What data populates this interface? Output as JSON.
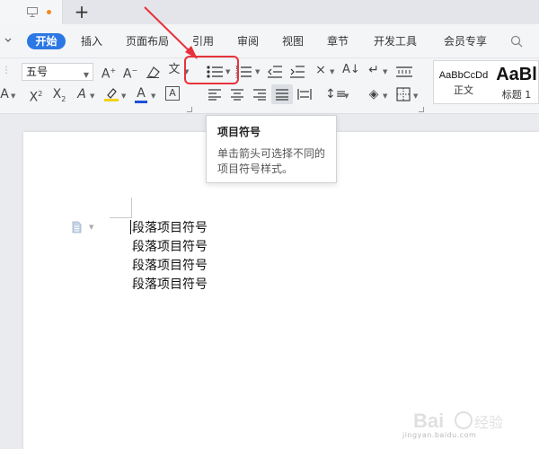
{
  "tabstrip": {
    "new_tab_symbol": "+",
    "unsaved_dot_color": "#f08a1c"
  },
  "menu": {
    "items": [
      "开始",
      "插入",
      "页面布局",
      "引用",
      "审阅",
      "视图",
      "章节",
      "开发工具",
      "会员专享"
    ],
    "search_label": "Q"
  },
  "ribbon": {
    "font_size_value": "五号",
    "icons": [
      "increase-font-icon",
      "decrease-font-icon",
      "clear-format-icon",
      "phonetic-guide-icon",
      "bullet-list-icon",
      "numbered-list-icon",
      "decrease-indent-icon",
      "increase-indent-icon",
      "chinese-layout-icon",
      "sort-icon",
      "line-break-icon",
      "character-scale-icon",
      "strikethrough-icon",
      "superscript-icon",
      "subscript-icon",
      "text-effect-icon",
      "highlight-icon",
      "font-color-icon",
      "char-border-icon",
      "align-left-icon",
      "align-center-icon",
      "align-right-icon",
      "justify-icon",
      "distributed-icon",
      "line-spacing-icon",
      "shading-icon",
      "borders-icon"
    ],
    "styles": [
      {
        "sample": "AaBbCcDd",
        "name": "正文"
      },
      {
        "sample": "AaBl",
        "name": "标题 1"
      }
    ]
  },
  "tooltip": {
    "title": "项目符号",
    "description": "单击箭头可选择不同的项目符号样式。"
  },
  "document": {
    "lines": [
      "段落项目符号",
      "段落项目符号",
      "段落项目符号",
      "段落项目符号"
    ]
  },
  "colors": {
    "accent": "#2b78e4",
    "annotation": "#e8323c",
    "highlight_yellow": "#f2d21b",
    "font_color_blue": "#1f4fd8"
  },
  "watermark": {
    "brand": "Baidu经验",
    "url": "jingyan.baidu.com"
  }
}
